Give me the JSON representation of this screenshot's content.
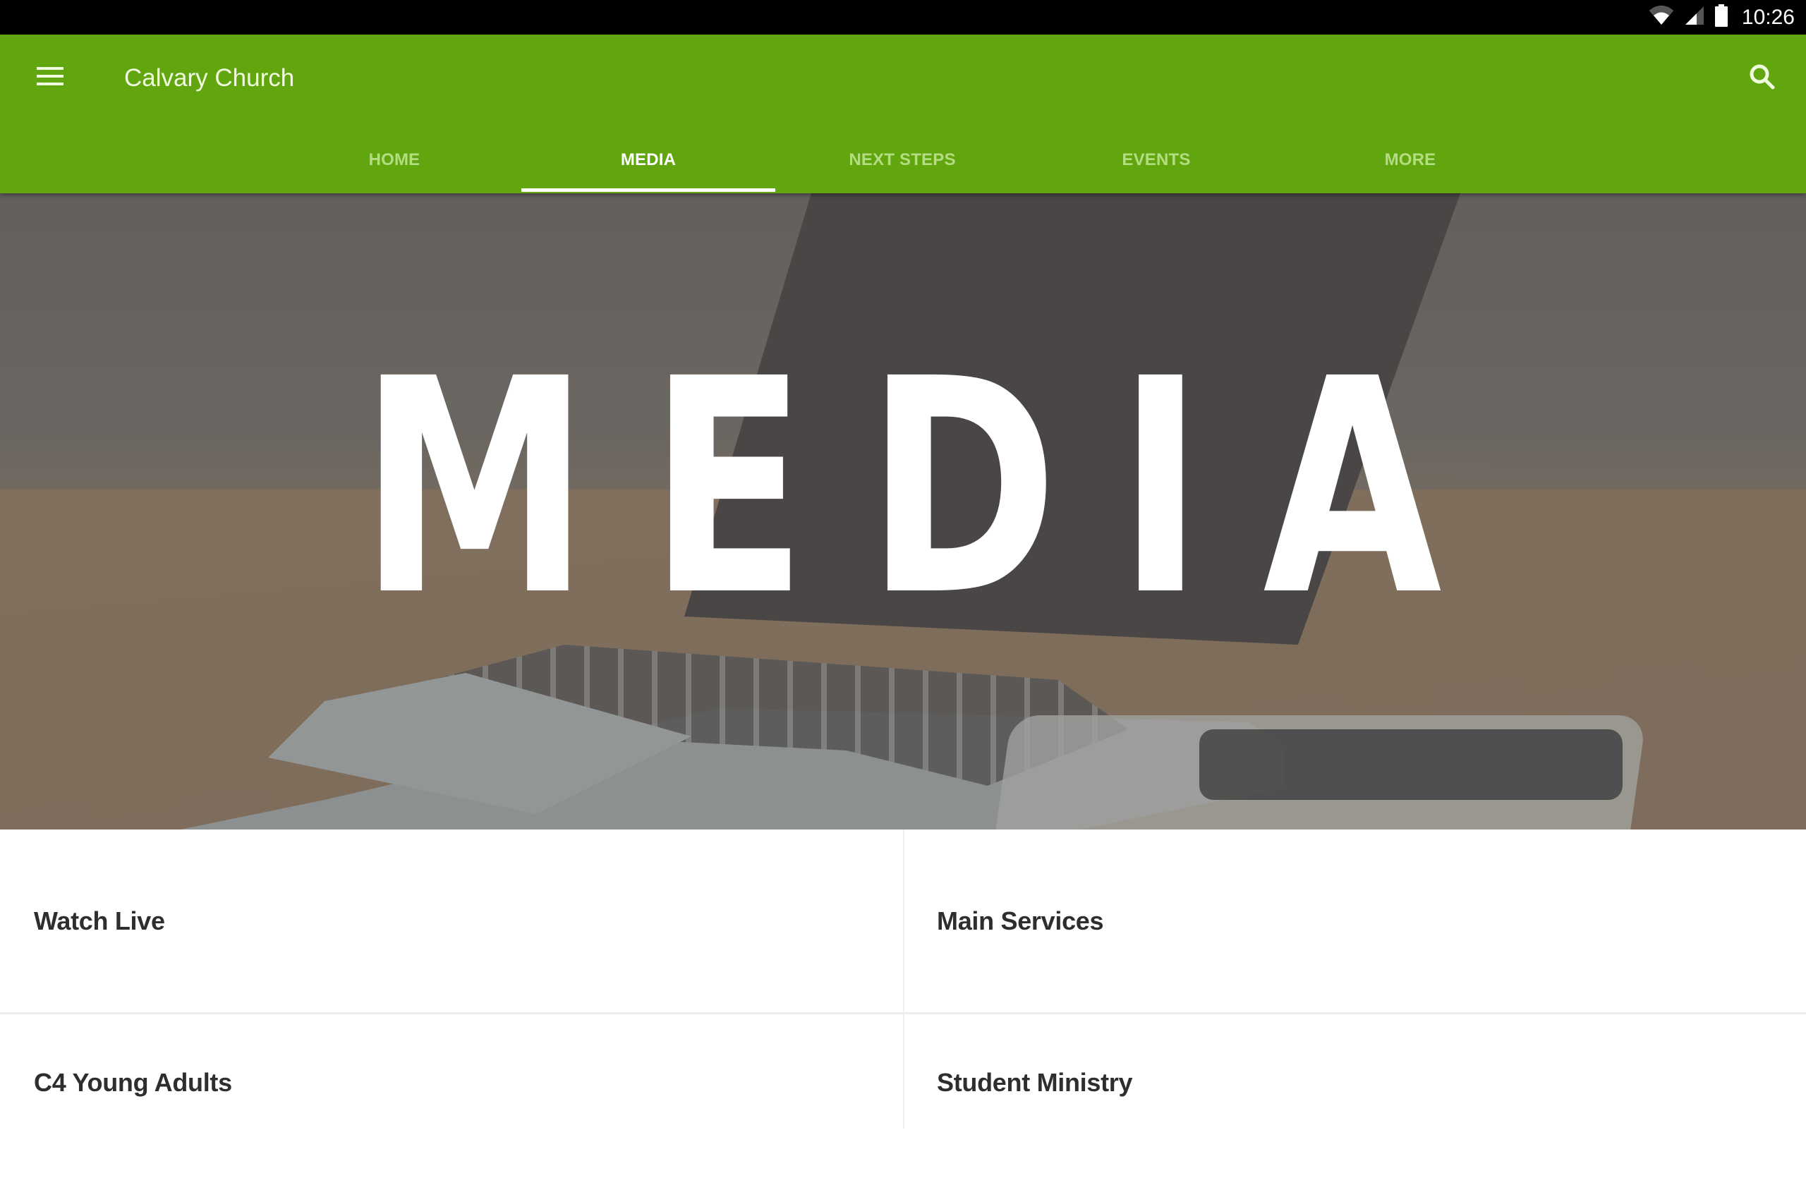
{
  "status_bar": {
    "time": "10:26",
    "icons": [
      "wifi-icon",
      "cell-signal-icon",
      "battery-icon"
    ]
  },
  "app_bar": {
    "title": "Calvary Church",
    "menu_icon": "hamburger-menu-icon",
    "search_icon": "search-icon",
    "colors": {
      "primary": "#61a60e",
      "tab_inactive": "#b3dd80",
      "tab_active": "#ffffff"
    }
  },
  "tabs": [
    {
      "label": "HOME",
      "active": false
    },
    {
      "label": "MEDIA",
      "active": true
    },
    {
      "label": "NEXT STEPS",
      "active": false
    },
    {
      "label": "EVENTS",
      "active": false
    },
    {
      "label": "MORE",
      "active": false
    }
  ],
  "hero": {
    "title": "MEDIA",
    "image": "laptop-on-wooden-desk"
  },
  "grid": {
    "items": [
      {
        "label": "Watch Live"
      },
      {
        "label": "Main Services"
      },
      {
        "label": "C4 Young Adults"
      },
      {
        "label": "Student Ministry"
      }
    ]
  }
}
